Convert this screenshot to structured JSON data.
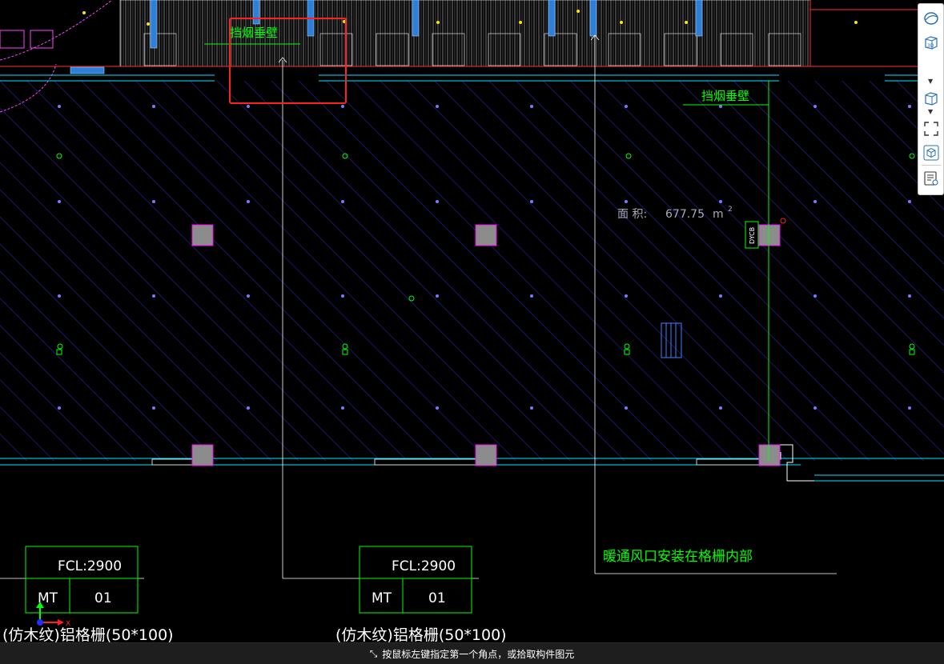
{
  "canvas": {
    "label_smoke_wall": "挡烟垂壁",
    "area_label": "面 积:",
    "area_value": "677.75",
    "area_unit": "m",
    "area_unit_exp": "2",
    "dycb_tag": "DYCB",
    "hvac_note": "暖通风口安装在格栅内部",
    "tags": [
      {
        "fcl": "FCL:2900",
        "code": "MT",
        "num": "01",
        "desc": "(仿木纹)铝格栅(50*100)"
      },
      {
        "fcl": "FCL:2900",
        "code": "MT",
        "num": "01",
        "desc": "(仿木纹)铝格栅(50*100)"
      }
    ],
    "ucs": {
      "x": "X",
      "y": "Y"
    }
  },
  "toolbar": {
    "items": [
      {
        "name": "orbit-view-icon"
      },
      {
        "name": "view-3d-icon",
        "label": "3D"
      },
      {
        "name": "view-cube-icon"
      },
      {
        "name": "zoom-extents-icon"
      },
      {
        "name": "component-select-icon"
      },
      {
        "name": "properties-icon"
      }
    ]
  },
  "status": {
    "prompt": "按鼠标左键指定第一个角点，或拾取构件图元"
  },
  "colors": {
    "hatch": "#2a2aa8",
    "green": "#00ff00",
    "highlight": "#ff2020",
    "magenta": "#ff00ff",
    "cyan": "#00e5ff"
  }
}
